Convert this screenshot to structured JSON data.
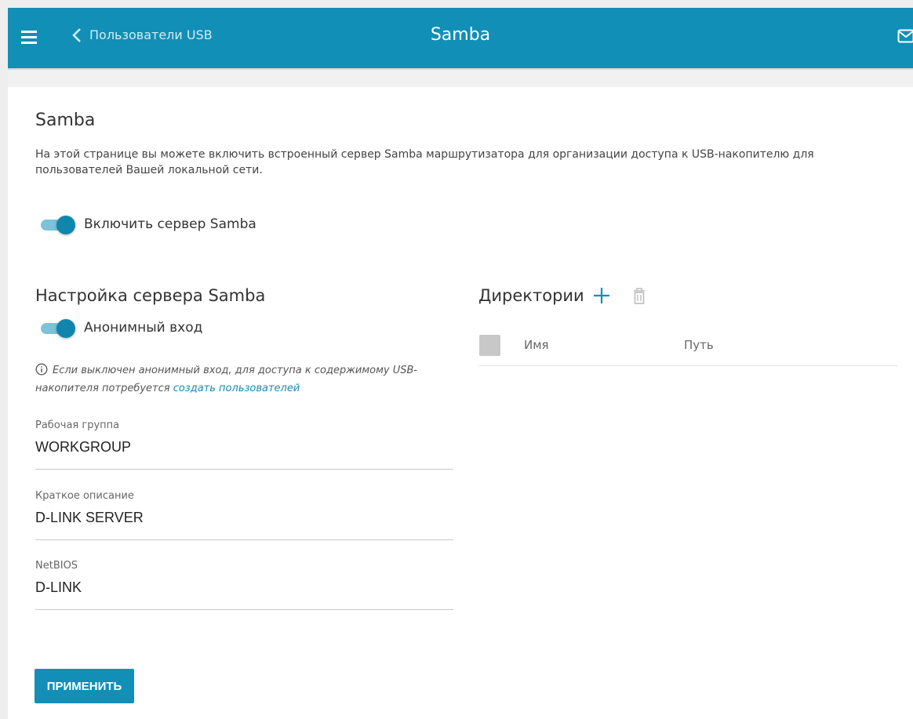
{
  "header": {
    "back_label": "Пользователи USB",
    "title": "Samba",
    "accent_color": "#118fb6"
  },
  "page": {
    "heading": "Samba",
    "description": "На этой странице вы можете включить встроенный сервер Samba маршрутизатора для организации доступа к USB-накопителю для пользователей Вашей локальной сети.",
    "enable_label": "Включить сервер Samba",
    "enable_on": true
  },
  "settings": {
    "heading": "Настройка сервера Samba",
    "anon_label": "Анонимный вход",
    "anon_on": true,
    "info_text": "Если выключен анонимный вход, для доступа к содержимому USB-накопителя потребуется ",
    "info_link": "создать пользователей",
    "fields": [
      {
        "label": "Рабочая группа",
        "value": "WORKGROUP"
      },
      {
        "label": "Краткое описание",
        "value": "D-LINK SERVER"
      },
      {
        "label": "NetBIOS",
        "value": "D-LINK"
      }
    ]
  },
  "directories": {
    "heading": "Директории",
    "columns": {
      "name": "Имя",
      "path": "Путь"
    }
  },
  "apply_label": "ПРИМЕНИТЬ",
  "icons": [
    "menu-icon",
    "chevron-left-icon",
    "mail-icon",
    "plus-icon",
    "trash-icon",
    "info-icon"
  ]
}
